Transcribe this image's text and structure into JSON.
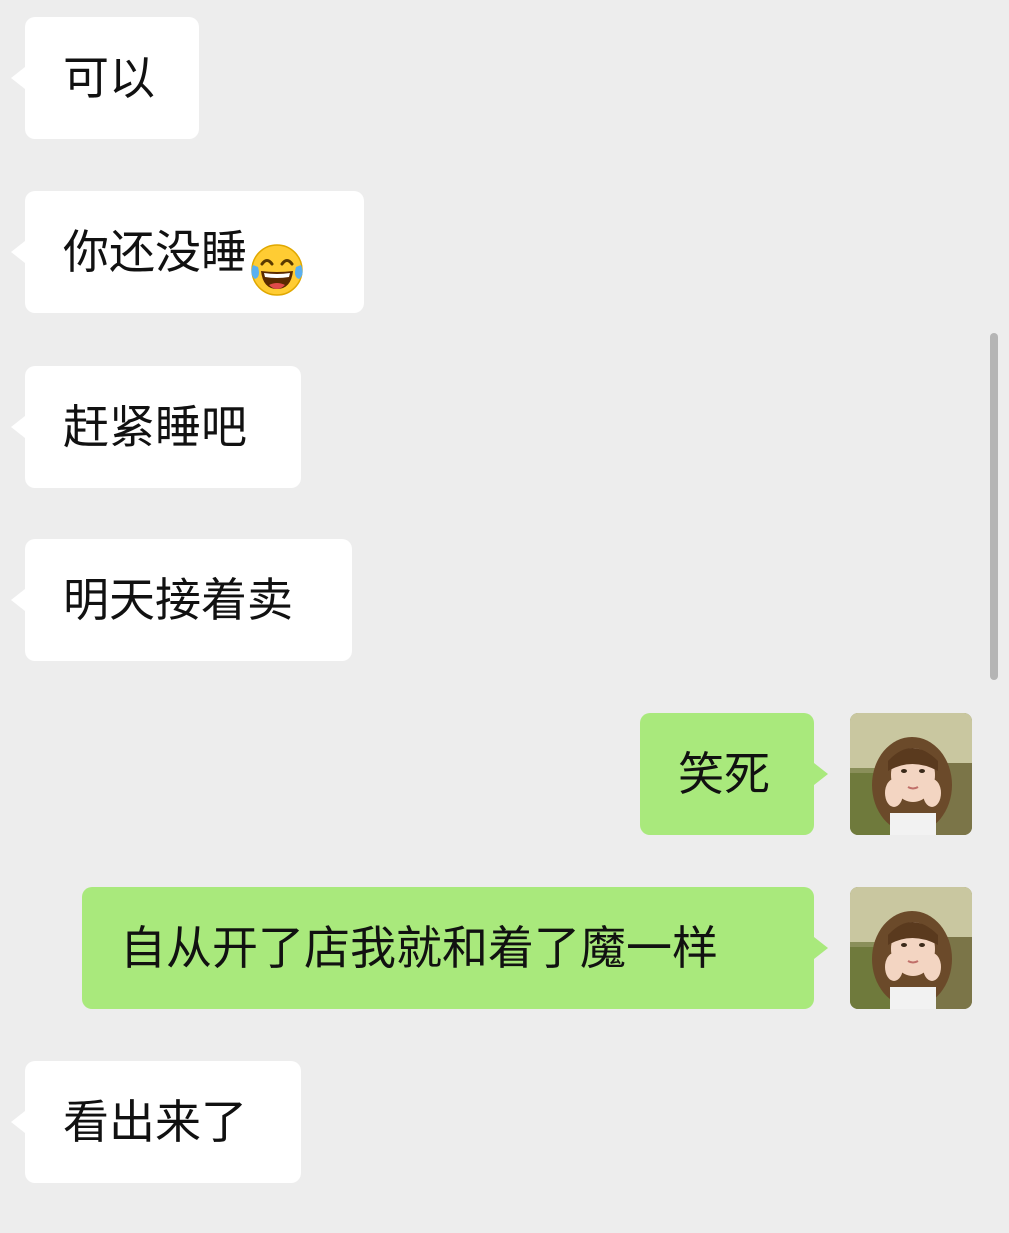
{
  "messages": [
    {
      "side": "left",
      "text": "可以"
    },
    {
      "side": "left",
      "text": "你还没睡",
      "emoji": "tears-of-joy-emoji"
    },
    {
      "side": "left",
      "text": "赶紧睡吧"
    },
    {
      "side": "left",
      "text": "明天接着卖"
    },
    {
      "side": "right",
      "text": "笑死",
      "avatar": "user-avatar"
    },
    {
      "side": "right",
      "text": "自从开了店我就和着了魔一样",
      "avatar": "user-avatar"
    },
    {
      "side": "left",
      "text": "看出来了"
    }
  ],
  "colors": {
    "background": "#ededed",
    "incoming_bubble": "#ffffff",
    "outgoing_bubble": "#a9e97c",
    "text": "#111111",
    "scrollbar": "#b5b5b5"
  }
}
